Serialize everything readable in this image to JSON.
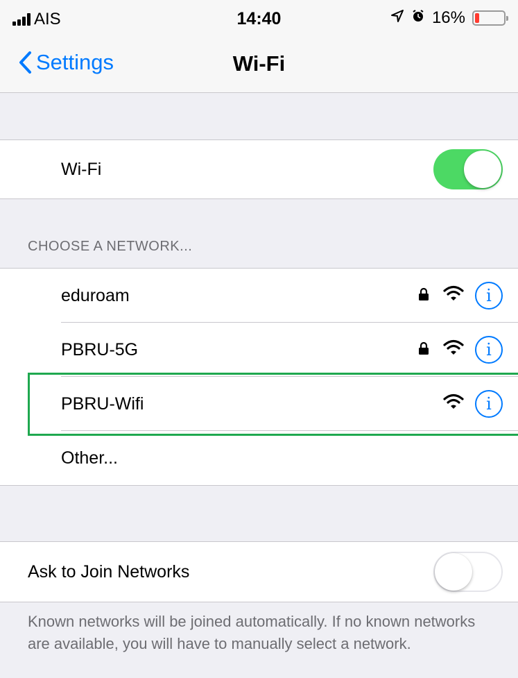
{
  "status_bar": {
    "carrier": "AIS",
    "time": "14:40",
    "battery_percent": "16%",
    "battery_level": 0.16,
    "icons": [
      "signal-icon",
      "location-icon",
      "alarm-icon",
      "battery-icon"
    ]
  },
  "nav": {
    "back_label": "Settings",
    "title": "Wi-Fi"
  },
  "wifi_toggle": {
    "label": "Wi-Fi",
    "state": "on"
  },
  "section_header": "CHOOSE A NETWORK...",
  "networks": [
    {
      "name": "eduroam",
      "locked": true,
      "highlighted": false
    },
    {
      "name": "PBRU-5G",
      "locked": true,
      "highlighted": false
    },
    {
      "name": "PBRU-Wifi",
      "locked": false,
      "highlighted": true
    }
  ],
  "other_label": "Other...",
  "ask_to_join": {
    "label": "Ask to Join Networks",
    "state": "off"
  },
  "footer": "Known networks will be joined automatically. If no known networks are available, you will have to manually select a network.",
  "colors": {
    "accent": "#007aff",
    "toggle_on": "#4cd964",
    "highlight": "#1fa84f",
    "battery_low": "#ff3b30"
  }
}
